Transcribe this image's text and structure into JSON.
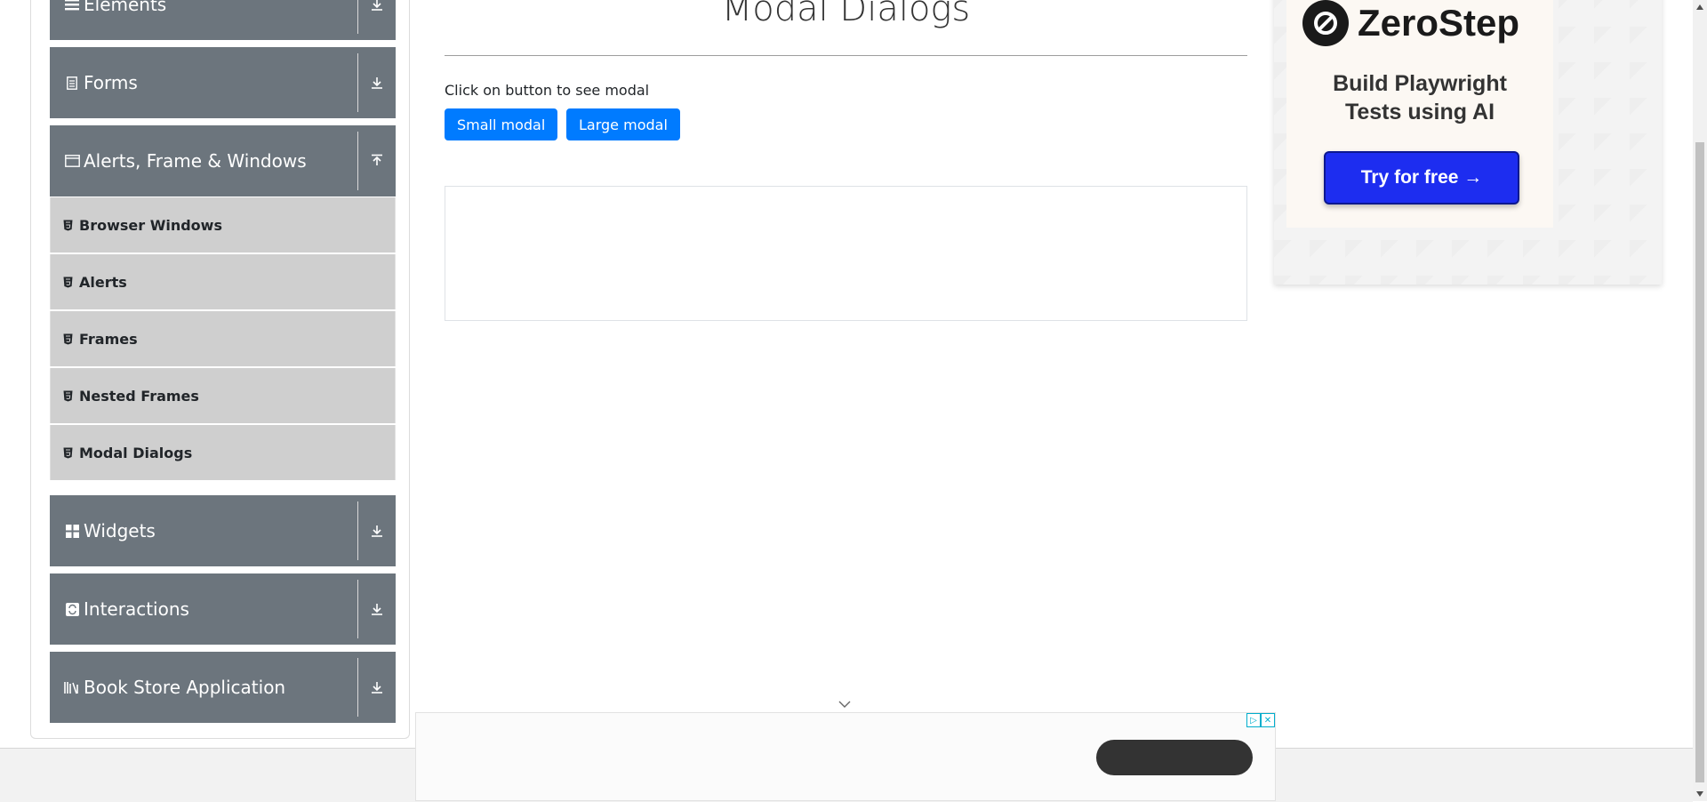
{
  "sidebar": {
    "groups": [
      {
        "label": "Elements",
        "icon": "hamburger-icon",
        "arrow": "download-icon",
        "expanded": false
      },
      {
        "label": "Forms",
        "icon": "document-icon",
        "arrow": "download-icon",
        "expanded": false
      },
      {
        "label": "Alerts, Frame & Windows",
        "icon": "window-icon",
        "arrow": "upload-icon",
        "expanded": true
      },
      {
        "label": "Widgets",
        "icon": "grid-icon",
        "arrow": "download-icon",
        "expanded": false
      },
      {
        "label": "Interactions",
        "icon": "refresh-icon",
        "arrow": "download-icon",
        "expanded": false
      },
      {
        "label": "Book Store Application",
        "icon": "books-icon",
        "arrow": "download-icon",
        "expanded": false
      }
    ],
    "subitems": [
      {
        "label": "Browser Windows"
      },
      {
        "label": "Alerts"
      },
      {
        "label": "Frames"
      },
      {
        "label": "Nested Frames"
      },
      {
        "label": "Modal Dialogs"
      }
    ]
  },
  "main": {
    "title": "Modal Dialogs",
    "instruction": "Click on button to see modal",
    "buttons": {
      "small": "Small modal",
      "large": "Large modal"
    }
  },
  "ad": {
    "brand": "ZeroStep",
    "headline_line1": "Build Playwright",
    "headline_line2": "Tests using AI",
    "cta": "Try for free →"
  },
  "colors": {
    "sidebar_header": "#6c757d",
    "sidebar_item": "#cfcfcf",
    "primary_button": "#007bff",
    "ad_cta": "#1d2df0"
  }
}
